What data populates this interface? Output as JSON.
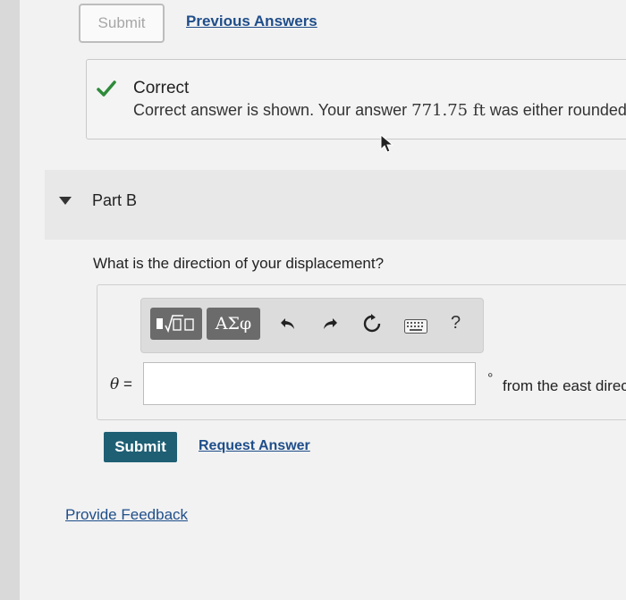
{
  "top": {
    "submit_label": "Submit",
    "previous_answers_label": "Previous Answers"
  },
  "feedback": {
    "title": "Correct",
    "message_prefix": "Correct answer is shown. Your answer ",
    "answer_value": "771.75 ft",
    "message_suffix": " was either rounded dif"
  },
  "part": {
    "label": "Part B",
    "question": "What is the direction of your displacement?"
  },
  "toolbar": {
    "templates_label": "▮√▯",
    "symbols_label": "ΑΣφ",
    "help_label": "?"
  },
  "answer": {
    "variable": "θ",
    "equals": " =",
    "value": "",
    "degree_symbol": "°",
    "units": "from the east direct"
  },
  "actions": {
    "submit_label": "Submit",
    "request_answer_label": "Request Answer",
    "provide_feedback_label": "Provide Feedback"
  },
  "colors": {
    "correct_green": "#2e8b3a",
    "link_blue": "#1f4e8a",
    "submit_bg": "#1f5f74"
  }
}
